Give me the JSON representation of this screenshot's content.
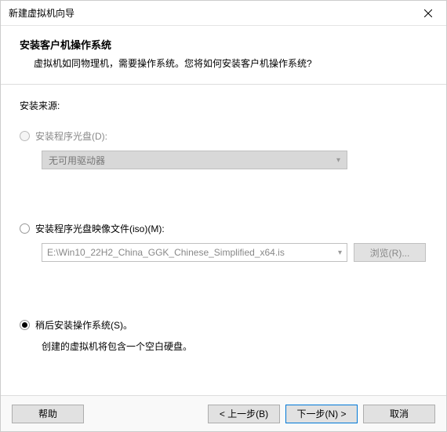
{
  "window": {
    "title": "新建虚拟机向导"
  },
  "header": {
    "title": "安装客户机操作系统",
    "desc": "虚拟机如同物理机，需要操作系统。您将如何安装客户机操作系统?"
  },
  "source": {
    "label": "安装来源:",
    "opt_disc": {
      "label": "安装程序光盘(D):",
      "dropdown": "无可用驱动器"
    },
    "opt_iso": {
      "label": "安装程序光盘映像文件(iso)(M):",
      "path": "E:\\Win10_22H2_China_GGK_Chinese_Simplified_x64.is",
      "browse": "浏览(R)..."
    },
    "opt_later": {
      "label": "稍后安装操作系统(S)。",
      "hint": "创建的虚拟机将包含一个空白硬盘。"
    }
  },
  "footer": {
    "help": "帮助",
    "back": "< 上一步(B)",
    "next": "下一步(N) >",
    "cancel": "取消"
  }
}
